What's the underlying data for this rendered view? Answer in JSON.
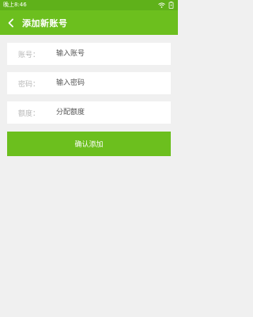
{
  "status_bar": {
    "time": "晚上8:46",
    "icons": [
      "wifi-icon",
      "battery-icon"
    ],
    "background": "#5fb11a"
  },
  "app_bar": {
    "title": "添加新账号",
    "back_icon": "back-arrow-icon",
    "background": "#6cbf1e"
  },
  "form": {
    "account": {
      "label": "账号：",
      "placeholder": "输入账号"
    },
    "password": {
      "label": "密码：",
      "placeholder": "输入密码"
    },
    "quota": {
      "label": "额度：",
      "placeholder": "分配额度"
    }
  },
  "confirm_button": {
    "label": "确认添加",
    "color": "#6cbf1e"
  }
}
